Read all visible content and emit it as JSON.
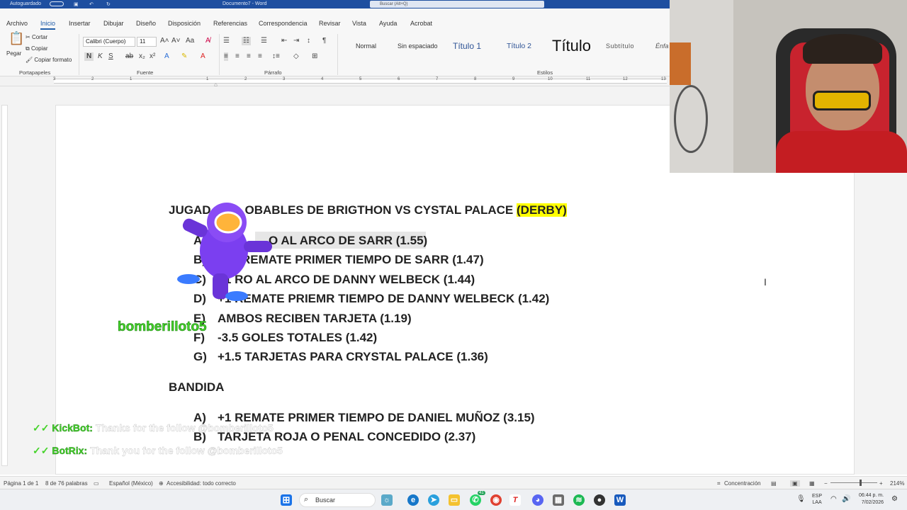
{
  "titlebar": {
    "autosave": "Autoguardado",
    "doc": "Documento7 - Word",
    "search_placeholder": "Buscar (Alt+Q)"
  },
  "tabs": [
    "Archivo",
    "Inicio",
    "Insertar",
    "Dibujar",
    "Diseño",
    "Disposición",
    "Referencias",
    "Correspondencia",
    "Revisar",
    "Vista",
    "Ayuda",
    "Acrobat"
  ],
  "ribbon": {
    "paste": "Pegar",
    "cut": "Cortar",
    "copy": "Copiar",
    "format_painter": "Copiar formato",
    "group_clipboard": "Portapapeles",
    "group_font": "Fuente",
    "group_paragraph": "Párrafo",
    "group_styles": "Estilos",
    "font_name": "Calibri (Cuerpo)",
    "font_size": "11",
    "styles": [
      "Normal",
      "Sin espaciado",
      "Título 1",
      "Título 2",
      "Título",
      "Subtítulo",
      "Énfa"
    ]
  },
  "ruler_numbers": [
    "3",
    "2",
    "1",
    "1",
    "2",
    "3",
    "4",
    "5",
    "6",
    "7",
    "8",
    "9",
    "10",
    "11",
    "12",
    "13"
  ],
  "document": {
    "title_prefix": "JUGAD",
    "title_mid": "OBABLES DE BRIGTHON VS CYSTAL PALACE ",
    "title_hl": "(DERBY)",
    "items1": [
      {
        "letter": "A)",
        "text": "O AL ARCO DE SARR (1.55)"
      },
      {
        "letter": "B)",
        "text": "REMATE PRIMER TIEMPO DE SARR (1.47)"
      },
      {
        "letter": "C)",
        "text": "+1 RO AL ARCO DE DANNY WELBECK (1.44)"
      },
      {
        "letter": "D)",
        "text": "+1 REMATE PRIEMR TIEMPO DE DANNY WELBECK (1.42)"
      },
      {
        "letter": "E)",
        "text": "AMBOS RECIBEN TARJETA (1.19)"
      },
      {
        "letter": "F)",
        "text": "-3.5 GOLES TOTALES (1.42)"
      },
      {
        "letter": "G)",
        "text": "+1.5 TARJETAS PARA CRYSTAL PALACE (1.36)"
      }
    ],
    "section2": "BANDIDA",
    "items2": [
      {
        "letter": "A)",
        "text": "+1 REMATE PRIMER TIEMPO DE DANIEL MUÑOZ (3.15)"
      },
      {
        "letter": "B)",
        "text": "TARJETA ROJA O PENAL CONCEDIDO (2.37)"
      }
    ]
  },
  "overlay": {
    "follower_name": "bomberilloto5",
    "kickbot_name": "KickBot:",
    "kickbot_msg": "Thanks for the follow @bomberilloto5",
    "botrix_name": "BotRix:",
    "botrix_msg": "Thank you for the follow @bomberilloto5"
  },
  "status": {
    "page": "Página 1 de 1",
    "words": "8 de 76 palabras",
    "language": "Español (México)",
    "accessibility": "Accesibilidad: todo correcto",
    "focus": "Concentración",
    "zoom": "214%"
  },
  "taskbar": {
    "search": "Buscar",
    "lang1": "ESP",
    "lang2": "LAA",
    "time": "06:44 p. m.",
    "date": "7/02/2026",
    "whatsapp_badge": "41"
  },
  "colors": {
    "accent": "#1f5ca8",
    "highlight": "#ffff00",
    "chat_green": "#45d32a"
  }
}
